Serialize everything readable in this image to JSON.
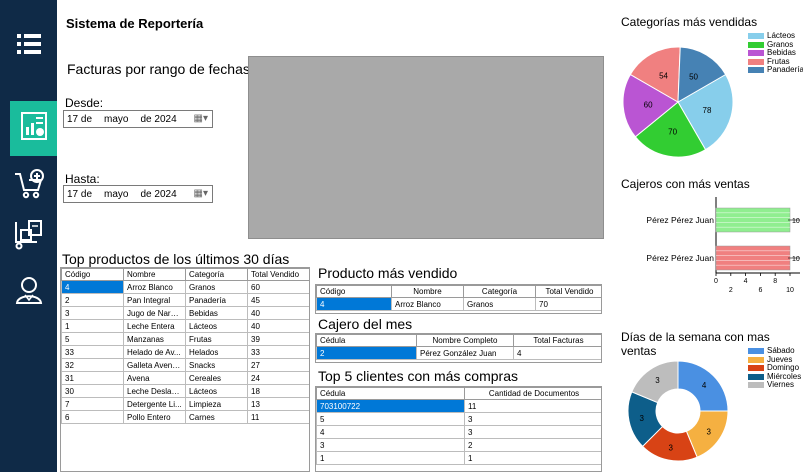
{
  "app": {
    "title": "Sistema de Reportería"
  },
  "sidebar": {
    "items": [
      {
        "name": "menu"
      },
      {
        "name": "reports"
      },
      {
        "name": "add-to-cart"
      },
      {
        "name": "delivery"
      },
      {
        "name": "user"
      }
    ]
  },
  "facturas": {
    "title": "Facturas por rango de fechas",
    "desde_label": "Desde:",
    "desde": {
      "day": "17 de",
      "month": "mayo",
      "year": "de 2024"
    },
    "hasta_label": "Hasta:",
    "hasta": {
      "day": "17 de",
      "month": "mayo",
      "year": "de 2024"
    }
  },
  "top_productos": {
    "title": "Top productos de los últimos 30 días",
    "headers": [
      "Código",
      "Nombre",
      "Categoría",
      "Total Vendido"
    ],
    "rows": [
      [
        "4",
        "Arroz Blanco",
        "Granos",
        "60"
      ],
      [
        "2",
        "Pan Integral",
        "Panadería",
        "45"
      ],
      [
        "3",
        "Jugo de Naranja",
        "Bebidas",
        "40"
      ],
      [
        "1",
        "Leche Entera",
        "Lácteos",
        "40"
      ],
      [
        "5",
        "Manzanas",
        "Frutas",
        "39"
      ],
      [
        "33",
        "Helado de Av...",
        "Helados",
        "33"
      ],
      [
        "32",
        "Galleta Avena ...",
        "Snacks",
        "27"
      ],
      [
        "31",
        "Avena",
        "Cereales",
        "24"
      ],
      [
        "30",
        "Leche Deslact...",
        "Lácteos",
        "18"
      ],
      [
        "7",
        "Detergente Li...",
        "Limpieza",
        "13"
      ],
      [
        "6",
        "Pollo Entero",
        "Carnes",
        "11"
      ]
    ]
  },
  "producto_mas_vendido": {
    "title": "Producto más vendido",
    "headers": [
      "Código",
      "Nombre",
      "Categoría",
      "Total Vendido"
    ],
    "rows": [
      [
        "4",
        "Arroz Blanco",
        "Granos",
        "70"
      ]
    ]
  },
  "cajero_del_mes": {
    "title": "Cajero del mes",
    "headers": [
      "Cédula",
      "Nombre Completo",
      "Total Facturas"
    ],
    "rows": [
      [
        "2",
        "Pérez González Juan",
        "4"
      ]
    ]
  },
  "top_clientes": {
    "title": "Top 5 clientes con más compras",
    "headers": [
      "Cédula",
      "Cantidad de Documentos"
    ],
    "rows": [
      [
        "703100722",
        "11"
      ],
      [
        "5",
        "3"
      ],
      [
        "4",
        "3"
      ],
      [
        "3",
        "2"
      ],
      [
        "1",
        "1"
      ]
    ]
  },
  "chart_data": [
    {
      "type": "pie",
      "title": "Categorías más vendidas",
      "categories": [
        "Lácteos",
        "Granos",
        "Bebidas",
        "Frutas",
        "Panadería"
      ],
      "values": [
        78,
        70,
        60,
        54,
        50
      ],
      "colors": [
        "#87ceeb",
        "#32cd32",
        "#ba55d3",
        "#f08080",
        "#4682b4"
      ],
      "legend": "top-right"
    },
    {
      "type": "bar",
      "title": "Cajeros con más ventas",
      "orientation": "horizontal",
      "categories": [
        "Pérez Pérez Juan",
        "Pérez Pérez Juan"
      ],
      "values": [
        10,
        10
      ],
      "colors": [
        "#90ee90",
        "#f08080"
      ],
      "x_ticks": [
        "0",
        "2",
        "4",
        "6",
        "8",
        "10"
      ],
      "xlim": [
        0,
        10
      ]
    },
    {
      "type": "pie",
      "subtype": "doughnut",
      "title": "Días de la semana con mas ventas",
      "categories": [
        "Sábado",
        "Jueves",
        "Domingo",
        "Miércoles",
        "Viernes"
      ],
      "values": [
        4,
        3,
        3,
        3,
        3
      ],
      "colors": [
        "#4a90e2",
        "#f5b041",
        "#d84315",
        "#0d5e8a",
        "#bdbdbd"
      ],
      "legend": "top-right"
    }
  ]
}
